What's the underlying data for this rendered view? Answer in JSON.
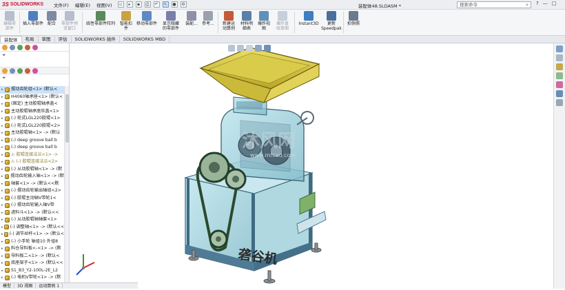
{
  "app": {
    "logo_ds": "3S",
    "logo_name": "SOLIDWORKS",
    "menus": [
      "文件(F)",
      "编辑(E)",
      "视图(V)"
    ],
    "doc_title": "装配体48.SLDASM *",
    "search_placeholder": "搜索命令",
    "window_buttons": [
      "?",
      "—",
      "□"
    ]
  },
  "ribbon": {
    "buttons": [
      {
        "label": "编辑零\n部件",
        "disabled": true,
        "color": "#6a7d9a"
      },
      {
        "label": "插入零部件",
        "disabled": false,
        "color": "#4f7fbf"
      },
      {
        "label": "配合",
        "disabled": false,
        "color": "#7e8aa0"
      },
      {
        "label": "零部件预\n览窗口",
        "disabled": true,
        "color": "#6a7d9a"
      },
      {
        "label": "线性零部件阵列",
        "disabled": false,
        "color": "#5a8a5a"
      },
      {
        "label": "智能扣\n件",
        "disabled": false,
        "color": "#c9a340"
      },
      {
        "label": "移动零部件",
        "disabled": false,
        "color": "#5f88c4"
      },
      {
        "label": "显示隐藏\n的零部件",
        "disabled": false,
        "color": "#7b7ea8"
      },
      {
        "label": "装配...",
        "disabled": false,
        "color": "#8f8fa8"
      },
      {
        "label": "参考...",
        "disabled": false,
        "color": "#9aa2b0"
      },
      {
        "label": "新建运\n动算例",
        "disabled": false,
        "color": "#c45a3a"
      },
      {
        "label": "材料明\n细表",
        "disabled": false,
        "color": "#5c7fa8"
      },
      {
        "label": "爆炸视\n图",
        "disabled": false,
        "color": "#5f90b8"
      },
      {
        "label": "爆炸直\n线草图",
        "disabled": true,
        "color": "#8ea0b8"
      },
      {
        "label": "Instant3D",
        "disabled": false,
        "color": "#3f7ec0"
      },
      {
        "label": "更新\nSpeedpak",
        "disabled": false,
        "color": "#4b6f9c"
      },
      {
        "label": "拍快照",
        "disabled": false,
        "color": "#6b7a8c"
      }
    ]
  },
  "tabs": [
    "装配体",
    "布局",
    "草图",
    "评估",
    "SOLIDWORKS 插件",
    "SOLIDWORKS MBD"
  ],
  "active_tab_index": 0,
  "tree": {
    "rows": [
      {
        "text": "摆动齿轮组<1> (默认<",
        "selected": true
      },
      {
        "text": "H4060轴承座<1> (默认<"
      },
      {
        "text": "(固定) 主动胶辊轴承盖<"
      },
      {
        "text": "主动胶辊轴承座压盖<1>"
      },
      {
        "text": "(-) 轮式LGL220胶辊<1>"
      },
      {
        "text": "(-) 轮式LGL220胶辊<2>"
      },
      {
        "text": "主动胶辊轴<1> -> (默认"
      },
      {
        "text": "(-) deep groove ball b"
      },
      {
        "text": "(-) deep groove ball b"
      },
      {
        "text": "⚠ 胶辊连接法兰<1> ->",
        "warn": true
      },
      {
        "text": "⚠ (-) 胶辊连接法兰<2>",
        "warn": true
      },
      {
        "text": "(-) 从动胶辊轴<1> -> (默"
      },
      {
        "text": "摆动齿轮输入轴<1> -> (默"
      },
      {
        "text": "轴套<1> -> (默认<<默"
      },
      {
        "text": "(-) 摆动齿轮输出轴组<2>"
      },
      {
        "text": "(-) 胶辊主动轴V带轮1<"
      },
      {
        "text": "(-) 摆动齿轮输入轴V带"
      },
      {
        "text": "进料斗<1> -> (默认<<"
      },
      {
        "text": "(-) 从动胶辊轴轴套<1>"
      },
      {
        "text": "(-) 调整轴<1> -> (默认<<"
      },
      {
        "text": "(-) 调节丝杆<1> -> (默认<"
      },
      {
        "text": "(-) 小手轮 轴径10 外径8"
      },
      {
        "text": "料仓导料板<-<1> -> (默"
      },
      {
        "text": "导料板二<1> -> (默认<"
      },
      {
        "text": "底座架子<1> -> (默认<<"
      },
      {
        "text": "S1_B3_Y2-100L-2E_L2"
      },
      {
        "text": "(-) 电机V带轮<1> -> (默"
      }
    ]
  },
  "bottom_tabs": [
    "模型",
    "3D 视图",
    "运动算例 1"
  ],
  "model": {
    "machine_label": "砻谷机",
    "watermark": "沐风网",
    "watermark_url": "www.mfcad.com"
  },
  "colors": {
    "hopper": "#d8c93a",
    "frame": "#4f7b96",
    "glass": "#9fd3de",
    "belt": "#2b4a2e"
  }
}
